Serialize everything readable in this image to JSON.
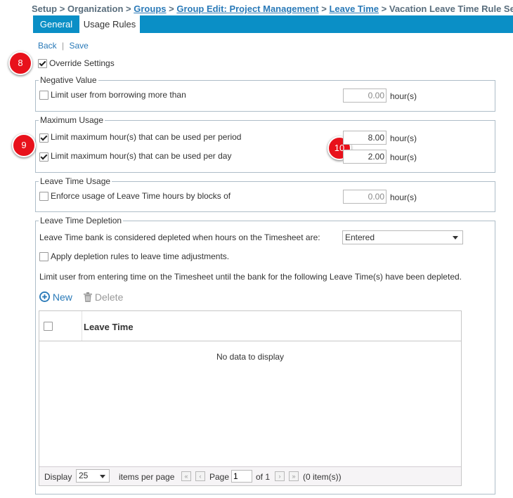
{
  "breadcrumb": {
    "items": [
      {
        "label": "Setup",
        "link": false
      },
      {
        "label": "Organization",
        "link": false
      },
      {
        "label": "Groups",
        "link": true
      },
      {
        "label": "Group Edit: Project Management",
        "link": true
      },
      {
        "label": "Leave Time",
        "link": true
      },
      {
        "label": "Vacation Leave Time Rule Setup",
        "link": false
      }
    ],
    "separator": ">"
  },
  "tabs": {
    "general": "General",
    "usage_rules": "Usage Rules"
  },
  "actions": {
    "back": "Back",
    "divider": "|",
    "save": "Save"
  },
  "callouts": {
    "override": "8",
    "max_usage": "9",
    "hours": "10"
  },
  "override": {
    "label": "Override Settings",
    "checked": true
  },
  "negative_value": {
    "legend": "Negative Value",
    "limit_label": "Limit user from borrowing more than",
    "limit_checked": false,
    "value": "0.00",
    "unit": "hour(s)"
  },
  "maximum_usage": {
    "legend": "Maximum Usage",
    "per_period_label": "Limit maximum hour(s) that can be used per period",
    "per_period_checked": true,
    "per_period_value": "8.00",
    "per_day_label": "Limit maximum hour(s) that can be used per day",
    "per_day_checked": true,
    "per_day_value": "2.00",
    "unit": "hour(s)"
  },
  "leave_time_usage": {
    "legend": "Leave Time Usage",
    "blocks_label": "Enforce usage of Leave Time hours by blocks of",
    "blocks_checked": false,
    "value": "0.00",
    "unit": "hour(s)"
  },
  "depletion": {
    "legend": "Leave Time Depletion",
    "bank_label": "Leave Time bank is considered depleted when hours on the Timesheet are:",
    "bank_value": "Entered",
    "adjustments_label": "Apply depletion rules to leave time adjustments.",
    "adjustments_checked": false,
    "limit_text": "Limit user from entering time on the Timesheet until the bank for the following Leave Time(s) have been depleted.",
    "new_label": "New",
    "delete_label": "Delete"
  },
  "grid": {
    "column_header": "Leave Time",
    "empty_text": "No data to display",
    "footer": {
      "display_label": "Display",
      "page_size": "25",
      "items_per_page": "items per page",
      "page_label": "Page",
      "page_value": "1",
      "of_label": "of 1",
      "count_label": "(0 item(s))"
    }
  },
  "colors": {
    "tab_bar": "#0a8fc6",
    "link": "#2a7ab8",
    "callout": "#e8111b",
    "new_link": "#2a7ab8"
  }
}
